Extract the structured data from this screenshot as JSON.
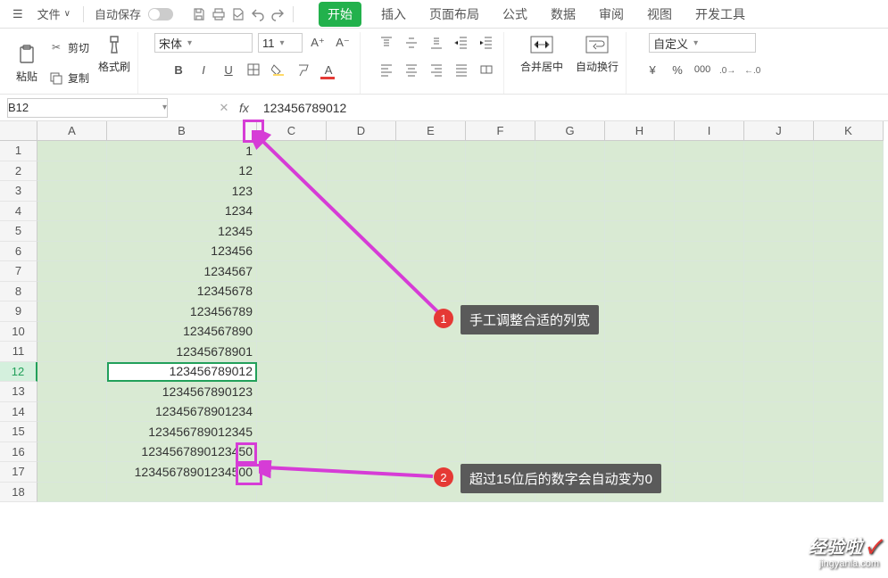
{
  "menubar": {
    "file": "文件",
    "autosave": "自动保存"
  },
  "tabs": {
    "start": "开始",
    "insert": "插入",
    "pagelayout": "页面布局",
    "formulas": "公式",
    "data": "数据",
    "review": "审阅",
    "view": "视图",
    "dev": "开发工具"
  },
  "ribbon": {
    "clipboard": {
      "cut": "剪切",
      "copy": "复制",
      "paste": "粘贴",
      "format_painter": "格式刷"
    },
    "font": {
      "name": "宋体",
      "size": "11"
    },
    "alignment": {
      "merge": "合并居中",
      "wrap": "自动换行"
    },
    "number": {
      "format": "自定义",
      "currency": "¥",
      "percent": "%"
    }
  },
  "namebox": "B12",
  "formula": "123456789012",
  "columns": [
    "A",
    "B",
    "C",
    "D",
    "E",
    "F",
    "G",
    "H",
    "I",
    "J",
    "K"
  ],
  "col_widths": {
    "A": 78,
    "B": 168,
    "default": 78
  },
  "rows": [
    {
      "n": 1,
      "b": "1"
    },
    {
      "n": 2,
      "b": "12"
    },
    {
      "n": 3,
      "b": "123"
    },
    {
      "n": 4,
      "b": "1234"
    },
    {
      "n": 5,
      "b": "12345"
    },
    {
      "n": 6,
      "b": "123456"
    },
    {
      "n": 7,
      "b": "1234567"
    },
    {
      "n": 8,
      "b": "12345678"
    },
    {
      "n": 9,
      "b": "123456789"
    },
    {
      "n": 10,
      "b": "1234567890"
    },
    {
      "n": 11,
      "b": "12345678901"
    },
    {
      "n": 12,
      "b": "123456789012"
    },
    {
      "n": 13,
      "b": "1234567890123"
    },
    {
      "n": 14,
      "b": "12345678901234"
    },
    {
      "n": 15,
      "b": "123456789012345"
    },
    {
      "n": 16,
      "b": "1234567890123450"
    },
    {
      "n": 17,
      "b": "12345678901234500"
    },
    {
      "n": 18,
      "b": ""
    }
  ],
  "selected_row": 12,
  "annotations": {
    "label1": "手工调整合适的列宽",
    "label2": "超过15位后的数字会自动变为0",
    "num1": "1",
    "num2": "2"
  },
  "watermark": {
    "line1": "经验啦",
    "check": "✓",
    "url": "jingyanla.com"
  }
}
